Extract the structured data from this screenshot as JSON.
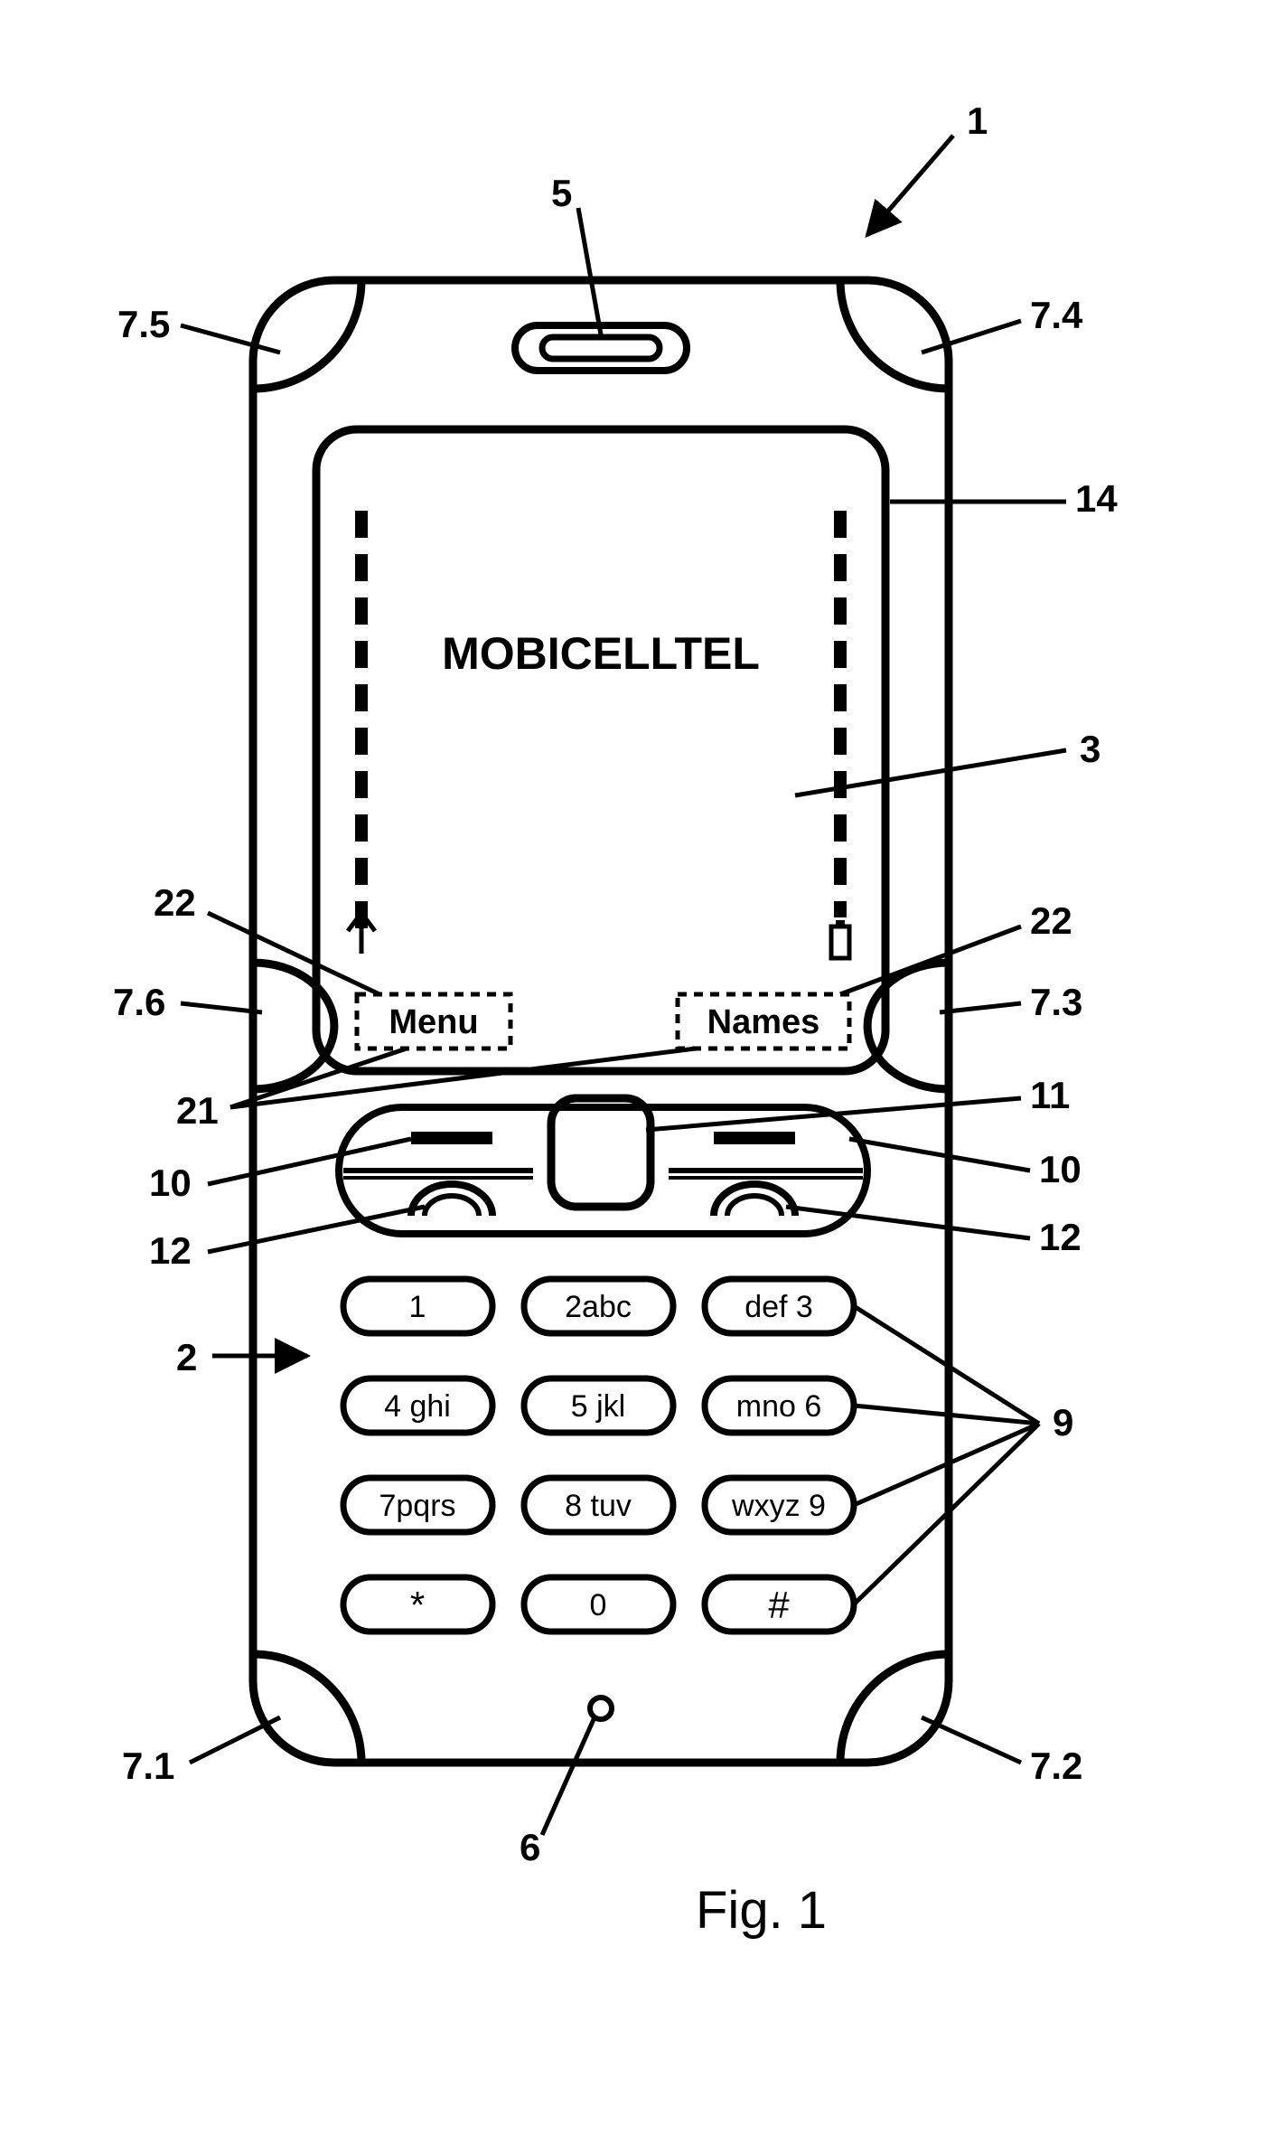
{
  "screen": {
    "operator": "MOBICELLTEL",
    "softkey_left": "Menu",
    "softkey_right": "Names"
  },
  "keypad": {
    "rows": [
      [
        "1",
        "2abc",
        "def 3"
      ],
      [
        "4 ghi",
        "5 jkl",
        "mno 6"
      ],
      [
        "7pqrs",
        "8 tuv",
        "wxyz 9"
      ],
      [
        "*",
        "0",
        "#"
      ]
    ]
  },
  "labels": {
    "fig": "Fig. 1",
    "n1": "1",
    "n2": "2",
    "n3": "3",
    "n5": "5",
    "n6": "6",
    "n7_1": "7.1",
    "n7_2": "7.2",
    "n7_3": "7.3",
    "n7_4": "7.4",
    "n7_5": "7.5",
    "n7_6": "7.6",
    "n9": "9",
    "n10a": "10",
    "n10b": "10",
    "n11": "11",
    "n12a": "12",
    "n12b": "12",
    "n14": "14",
    "n21": "21",
    "n22a": "22",
    "n22b": "22"
  }
}
